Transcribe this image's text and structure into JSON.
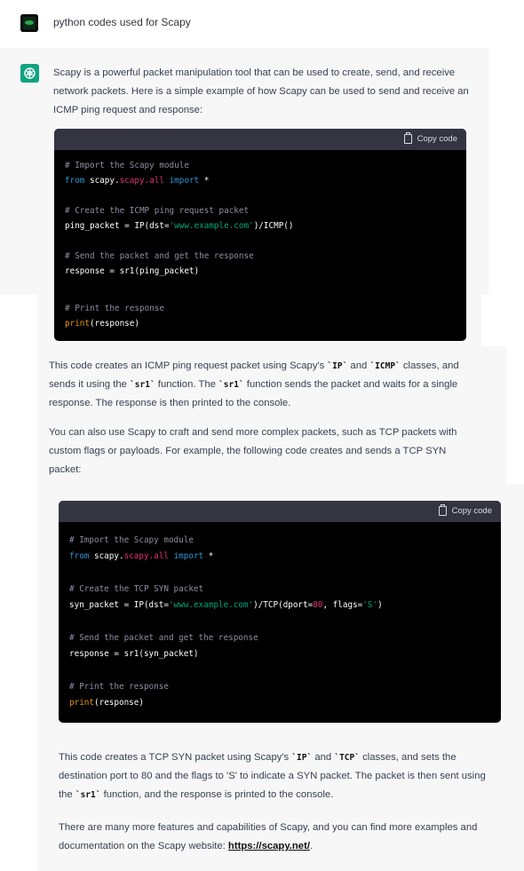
{
  "user_message": "python codes used for Scapy",
  "intro": "Scapy is a powerful packet manipulation tool that can be used to create, send, and receive network packets. Here is a simple example of how Scapy can be used to send and receive an ICMP ping request and response:",
  "copy_label": "Copy code",
  "code1": {
    "comment1": "# Import the Scapy module",
    "from": "from",
    "module": "scapy.all",
    "import": "import",
    "star": " *",
    "comment2": "# Create the ICMP ping request packet",
    "assign_a": "ping_packet = IP(dst=",
    "url": "'www.example.com'",
    "assign_b": ")/ICMP()",
    "comment3": "# Send the packet and get the response",
    "send": "response = sr1(ping_packet)",
    "comment4": "# Print the response",
    "print": "print",
    "print_arg": "(response)"
  },
  "para2": {
    "a": "This code creates an ICMP ping request packet using Scapy's ",
    "ip": "`IP`",
    "b": " and ",
    "icmp": "`ICMP`",
    "c": " classes, and sends it using the ",
    "sr1a": "`sr1`",
    "d": " function. The ",
    "sr1b": "`sr1`",
    "e": " function sends the packet and waits for a single response. The response is then printed to the console."
  },
  "para3": "You can also use Scapy to craft and send more complex packets, such as TCP packets with custom flags or payloads. For example, the following code creates and sends a TCP SYN packet:",
  "code2": {
    "comment1": "# Import the Scapy module",
    "from": "from",
    "module": "scapy.all",
    "import": "import",
    "star": " *",
    "comment2": "# Create the TCP SYN packet",
    "assign_a": "syn_packet = IP(dst=",
    "url": "'www.example.com'",
    "assign_b": ")/TCP(dport=",
    "port": "80",
    "assign_c": ", flags=",
    "flag": "'S'",
    "assign_d": ")",
    "comment3": "# Send the packet and get the response",
    "send": "response = sr1(syn_packet)",
    "comment4": "# Print the response",
    "print": "print",
    "print_arg": "(response)"
  },
  "para4": {
    "a": "This code creates a TCP SYN packet using Scapy's ",
    "ip": "`IP`",
    "b": " and ",
    "tcp": "`TCP`",
    "c": " classes, and sets the destination port to 80 and the flags to 'S' to indicate a SYN packet. The packet is then sent using the ",
    "sr1": "`sr1`",
    "d": " function, and the response is printed to the console."
  },
  "para5": {
    "a": "There are many more features and capabilities of Scapy, and you can find more examples and documentation on the Scapy website: ",
    "link": "https://scapy.net/",
    "b": "."
  }
}
